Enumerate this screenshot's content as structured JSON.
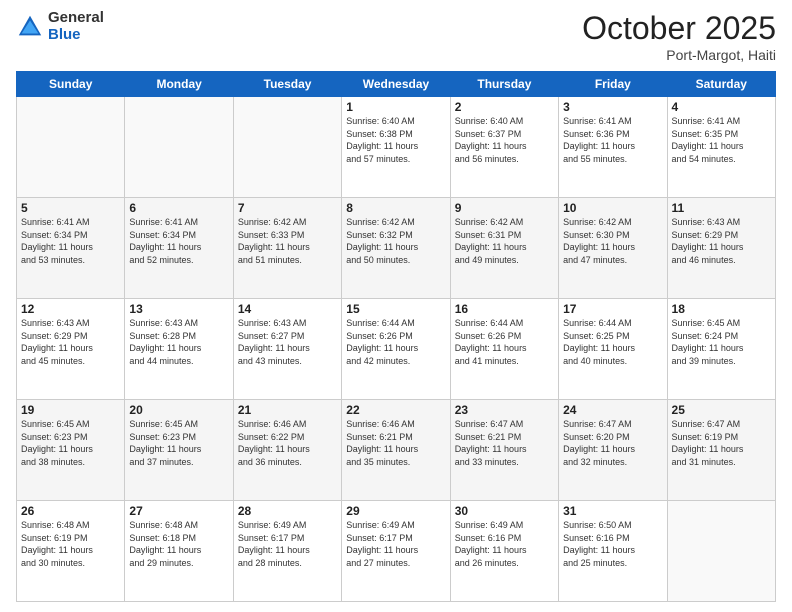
{
  "header": {
    "logo_general": "General",
    "logo_blue": "Blue",
    "month_title": "October 2025",
    "subtitle": "Port-Margot, Haiti"
  },
  "days_of_week": [
    "Sunday",
    "Monday",
    "Tuesday",
    "Wednesday",
    "Thursday",
    "Friday",
    "Saturday"
  ],
  "weeks": [
    [
      {
        "day": "",
        "info": ""
      },
      {
        "day": "",
        "info": ""
      },
      {
        "day": "",
        "info": ""
      },
      {
        "day": "1",
        "info": "Sunrise: 6:40 AM\nSunset: 6:38 PM\nDaylight: 11 hours\nand 57 minutes."
      },
      {
        "day": "2",
        "info": "Sunrise: 6:40 AM\nSunset: 6:37 PM\nDaylight: 11 hours\nand 56 minutes."
      },
      {
        "day": "3",
        "info": "Sunrise: 6:41 AM\nSunset: 6:36 PM\nDaylight: 11 hours\nand 55 minutes."
      },
      {
        "day": "4",
        "info": "Sunrise: 6:41 AM\nSunset: 6:35 PM\nDaylight: 11 hours\nand 54 minutes."
      }
    ],
    [
      {
        "day": "5",
        "info": "Sunrise: 6:41 AM\nSunset: 6:34 PM\nDaylight: 11 hours\nand 53 minutes."
      },
      {
        "day": "6",
        "info": "Sunrise: 6:41 AM\nSunset: 6:34 PM\nDaylight: 11 hours\nand 52 minutes."
      },
      {
        "day": "7",
        "info": "Sunrise: 6:42 AM\nSunset: 6:33 PM\nDaylight: 11 hours\nand 51 minutes."
      },
      {
        "day": "8",
        "info": "Sunrise: 6:42 AM\nSunset: 6:32 PM\nDaylight: 11 hours\nand 50 minutes."
      },
      {
        "day": "9",
        "info": "Sunrise: 6:42 AM\nSunset: 6:31 PM\nDaylight: 11 hours\nand 49 minutes."
      },
      {
        "day": "10",
        "info": "Sunrise: 6:42 AM\nSunset: 6:30 PM\nDaylight: 11 hours\nand 47 minutes."
      },
      {
        "day": "11",
        "info": "Sunrise: 6:43 AM\nSunset: 6:29 PM\nDaylight: 11 hours\nand 46 minutes."
      }
    ],
    [
      {
        "day": "12",
        "info": "Sunrise: 6:43 AM\nSunset: 6:29 PM\nDaylight: 11 hours\nand 45 minutes."
      },
      {
        "day": "13",
        "info": "Sunrise: 6:43 AM\nSunset: 6:28 PM\nDaylight: 11 hours\nand 44 minutes."
      },
      {
        "day": "14",
        "info": "Sunrise: 6:43 AM\nSunset: 6:27 PM\nDaylight: 11 hours\nand 43 minutes."
      },
      {
        "day": "15",
        "info": "Sunrise: 6:44 AM\nSunset: 6:26 PM\nDaylight: 11 hours\nand 42 minutes."
      },
      {
        "day": "16",
        "info": "Sunrise: 6:44 AM\nSunset: 6:26 PM\nDaylight: 11 hours\nand 41 minutes."
      },
      {
        "day": "17",
        "info": "Sunrise: 6:44 AM\nSunset: 6:25 PM\nDaylight: 11 hours\nand 40 minutes."
      },
      {
        "day": "18",
        "info": "Sunrise: 6:45 AM\nSunset: 6:24 PM\nDaylight: 11 hours\nand 39 minutes."
      }
    ],
    [
      {
        "day": "19",
        "info": "Sunrise: 6:45 AM\nSunset: 6:23 PM\nDaylight: 11 hours\nand 38 minutes."
      },
      {
        "day": "20",
        "info": "Sunrise: 6:45 AM\nSunset: 6:23 PM\nDaylight: 11 hours\nand 37 minutes."
      },
      {
        "day": "21",
        "info": "Sunrise: 6:46 AM\nSunset: 6:22 PM\nDaylight: 11 hours\nand 36 minutes."
      },
      {
        "day": "22",
        "info": "Sunrise: 6:46 AM\nSunset: 6:21 PM\nDaylight: 11 hours\nand 35 minutes."
      },
      {
        "day": "23",
        "info": "Sunrise: 6:47 AM\nSunset: 6:21 PM\nDaylight: 11 hours\nand 33 minutes."
      },
      {
        "day": "24",
        "info": "Sunrise: 6:47 AM\nSunset: 6:20 PM\nDaylight: 11 hours\nand 32 minutes."
      },
      {
        "day": "25",
        "info": "Sunrise: 6:47 AM\nSunset: 6:19 PM\nDaylight: 11 hours\nand 31 minutes."
      }
    ],
    [
      {
        "day": "26",
        "info": "Sunrise: 6:48 AM\nSunset: 6:19 PM\nDaylight: 11 hours\nand 30 minutes."
      },
      {
        "day": "27",
        "info": "Sunrise: 6:48 AM\nSunset: 6:18 PM\nDaylight: 11 hours\nand 29 minutes."
      },
      {
        "day": "28",
        "info": "Sunrise: 6:49 AM\nSunset: 6:17 PM\nDaylight: 11 hours\nand 28 minutes."
      },
      {
        "day": "29",
        "info": "Sunrise: 6:49 AM\nSunset: 6:17 PM\nDaylight: 11 hours\nand 27 minutes."
      },
      {
        "day": "30",
        "info": "Sunrise: 6:49 AM\nSunset: 6:16 PM\nDaylight: 11 hours\nand 26 minutes."
      },
      {
        "day": "31",
        "info": "Sunrise: 6:50 AM\nSunset: 6:16 PM\nDaylight: 11 hours\nand 25 minutes."
      },
      {
        "day": "",
        "info": ""
      }
    ]
  ]
}
